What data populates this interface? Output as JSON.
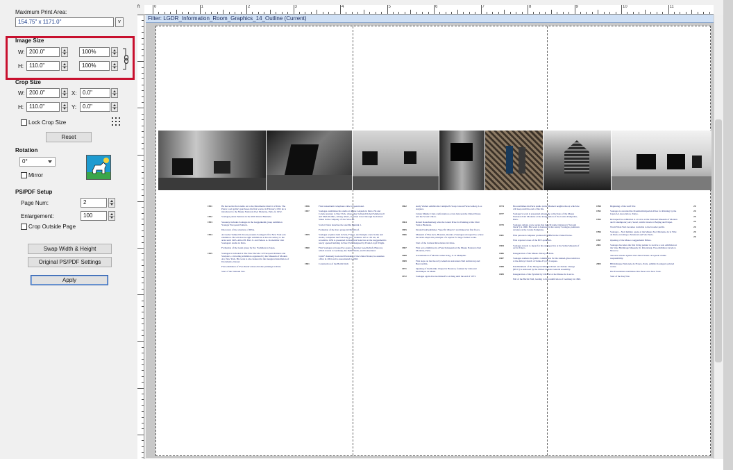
{
  "print_area": {
    "label": "Maximum Print Area:",
    "value": "154.75\" x 1171.0\"",
    "dropdown_glyph": "v"
  },
  "image_size": {
    "label": "Image Size",
    "w_label": "W:",
    "w_value": "200.0\"",
    "w_pct": "100%",
    "h_label": "H:",
    "h_value": "110.0\"",
    "h_pct": "100%"
  },
  "crop_size": {
    "label": "Crop Size",
    "w_label": "W:",
    "w_value": "200.0\"",
    "x_label": "X:",
    "x_value": "0.0\"",
    "h_label": "H:",
    "h_value": "110.0\"",
    "y_label": "Y:",
    "y_value": "0.0\"",
    "lock_label": "Lock Crop Size",
    "reset_label": "Reset"
  },
  "rotation": {
    "label": "Rotation",
    "value": "0°",
    "mirror_label": "Mirror"
  },
  "ps_pdf": {
    "label": "PS/PDF Setup",
    "page_num_label": "Page Num:",
    "page_num_value": "2",
    "enlargement_label": "Enlargement:",
    "enlargement_value": "100",
    "crop_outside_label": "Crop Outside Page"
  },
  "buttons": {
    "swap": "Swap Width & Height",
    "original": "Original PS/PDF Settings",
    "apply": "Apply"
  },
  "ruler": {
    "unit": "ft",
    "top_numbers": [
      "0",
      "1",
      "2",
      "3",
      "4",
      "5",
      "6",
      "7",
      "8",
      "9",
      "10",
      "11"
    ]
  },
  "filter_bar": {
    "text": "Filter: LGDR_Information_Room_Graphics_14_Outline (Current)"
  },
  "colors": {
    "highlight": "#c8102e",
    "timeline_text": "#1c2a7a",
    "filter_bg": "#cfe0f5"
  },
  "timeline": [
    [
      {
        "year": "1951",
        "text": "He moves his first studio on to the Montmartre district of Paris. The Pierre Loeb gallery purchases his first works. In February 1952 he is introduced to the Musée National d'Art Moderne, Paris, in 1952."
      },
      {
        "year": "1952",
        "text": "Soulages paints Peinture in the 20th Venice Biennale."
      },
      {
        "year": "1953",
        "text": "Sweeney includes Soulages in the Guggenheim group exhibition Younger European Painters."
      },
      {
        "year": "",
        "text": "Discovery of the structure of DNA."
      },
      {
        "year": "1954",
        "text": "Art dealer Samuel M. Kootz presents Soulages's first New York solo exhibition. He will devote eight exhibitions at Kootz Gallery to the artist until 1965. Alfred H. Barr Jr. and Nelson A. Rockefeller visit Soulages's studio in Paris."
      },
      {
        "year": "",
        "text": "Formation of the Gutai group by Jiro Yoshihara in Japan."
      },
      {
        "year": "1955",
        "text": "Soulages is included in The New Decade: 22 European Painters and Sculptors, a traveling exhibition organized by the Museum of Modern Art, New York. His work is also featured in the inaugural installation of Documenta, Kassel."
      },
      {
        "year": "",
        "text": "First exhibition of Yves Klein's monochrome paintings in Paris."
      },
      {
        "year": "",
        "text": "Start of the Vietnam War."
      }
    ],
    [
      {
        "year": "1956",
        "text": "First transatlantic telephone cable is operational."
      },
      {
        "year": "1957",
        "text": "Soulages establishes his studio at 48 rue Galande in Paris. He and Colette journey to New York, where they befriend Robert Motherwell and Mark Rothko, among others, and then travel through the United States in the company of Zao Wou-Ki."
      },
      {
        "year": "",
        "text": "Soviet Union launches the satellite Sputnik 1."
      },
      {
        "year": "",
        "text": "Formation of the Zero group in Düsseldorf."
      },
      {
        "year": "1959",
        "text": "Soulages acquires land in Sète, France, and designs a new home and studio, completed the following year. Peinture 195 x 130 cm, 20 novembre 1956 is presented in Inaugural Selection at the Guggenheim's newly opened building in New York designed by Frank Lloyd Wright."
      },
      {
        "year": "1960",
        "text": "First Soulages retrospective opens at Kestner Gesellschaft, Hanover, which travels to Germany, the Netherlands, and Switzerland."
      },
      {
        "year": "",
        "text": "John F. Kennedy is elected President of the United States; he assumes office in 1961 and is assassinated in 1963."
      },
      {
        "year": "1961",
        "text": "Construction of the Berlin Wall."
      }
    ],
    [
      {
        "year": "1962",
        "text": "Andy Warhol exhibits his Campbell's Soup Cans at Ferus Gallery, Los Angeles."
      },
      {
        "year": "",
        "text": "Cuban Missile Crisis confrontation occurs between the United States and the Soviet Union."
      },
      {
        "year": "1964",
        "text": "Robert Rauschenberg wins the Grand Prize for Painting at the 32nd Venice Biennale."
      },
      {
        "year": "1965",
        "text": "Donald Judd publishes \"Specific Objects\" and makes his first floors."
      },
      {
        "year": "1966",
        "text": "Museum of Fine Arts, Houston, mounts a Soulages retrospective, where the artist adopts his principle of a reprise for large-format works."
      },
      {
        "year": "",
        "text": "Start of the Cultural Revolution in China."
      },
      {
        "year": "1967",
        "text": "First solo exhibition in a French museum at the Musée National d'Art Moderne, Paris."
      },
      {
        "year": "1968",
        "text": "Assassination of Martin Luther King, Jr. in Memphis."
      },
      {
        "year": "1969",
        "text": "First steps on the moon by American astronauts Neil Armstrong and Buzz Aldrin."
      },
      {
        "year": "1971",
        "text": "Opening of the Rothko Chapel in Houston, founded by John and Dominique de Menil."
      },
      {
        "year": "1972",
        "text": "Soulages again devotes himself to etching until the end of 1973."
      }
    ],
    [
      {
        "year": "1974",
        "text": "He establishes his Paris studio in the Maubert neighborhood, which he will keep until the end of his life."
      },
      {
        "year": "1977",
        "text": "Soulages's work is presented among the collections of the Musée National d'Art Moderne at the inauguration of the Centre Pompidou, Paris."
      },
      {
        "year": "1979",
        "text": "Soulages debuts a new series that he will name Outrenoir (\"beyond black\") in 1990. His work is featured in the survey Soulages, peintures récentes at the Centre Pompidou."
      },
      {
        "year": "1981",
        "text": "First personal computer produced by IBM in the United States."
      },
      {
        "year": "",
        "text": "First reported cases of the HIV epidemic."
      },
      {
        "year": "1984",
        "text": "Soulages travels to Japan for his retrospective at the Seibu Museum of Art in Tokyo."
      },
      {
        "year": "1986",
        "text": "Inauguration of the Musée d'Orsay in Paris."
      },
      {
        "year": "1987",
        "text": "Soulages realizes the public commission for the stained-glass windows at the Abbey Church of Sainte-Foy in Conques."
      },
      {
        "year": "1988",
        "text": "Establishment of the Intergovernmental Panel on Climate Change (IPCC) is endorsed by the United Nations General Assembly."
      },
      {
        "year": "1989",
        "text": "Inauguration of the Pyramid by I.M. Pei at the Musée du Louvre."
      },
      {
        "year": "",
        "text": "Fall of the Berlin Wall, leading to the reunification of Germany in 1990."
      }
    ],
    [
      {
        "year": "1990",
        "text": "Beginning of the Gulf War."
      },
      {
        "year": "1992",
        "text": "Soulages is awarded the Praemium Imperiale Prize for Painting by the Japan Art Association, Tokyo."
      },
      {
        "year": "1993",
        "text": "Retrospective exhibition is on view at the National Museum of Modern and Contemporary Art, Seoul, which travels to Beijing and Taipei."
      },
      {
        "year": "",
        "text": "World Wide Web becomes available to the broader public."
      },
      {
        "year": "1996",
        "text": "Soulages – Noir lumière opens at the Musée d'Art Moderne de la Ville de Paris, traveling to Montreal and São Paulo."
      },
      {
        "year": "1997",
        "text": "Opening of the Museo Guggenheim Bilbao."
      },
      {
        "year": "2001",
        "text": "Soulages becomes the first living painter to receive a solo exhibition at the State Hermitage Museum, St. Petersburg. The exhibition travels to Moscow."
      },
      {
        "year": "",
        "text": "Terrorist attacks against the United States. Al-Qaeda claims responsibility."
      },
      {
        "year": "2003",
        "text": "Bibliothèque Nationale de France, Paris, exhibits Soulages's printed works."
      },
      {
        "year": "",
        "text": "Dia Foundation establishes Dia: Beacon in New York."
      },
      {
        "year": "",
        "text": "Start of the Iraq War."
      }
    ],
    [
      {
        "year": "20",
        "text": ""
      },
      {
        "year": "20",
        "text": ""
      },
      {
        "year": "20",
        "text": ""
      },
      {
        "year": "20",
        "text": ""
      },
      {
        "year": "20",
        "text": ""
      },
      {
        "year": "20",
        "text": ""
      },
      {
        "year": "20",
        "text": ""
      }
    ]
  ]
}
